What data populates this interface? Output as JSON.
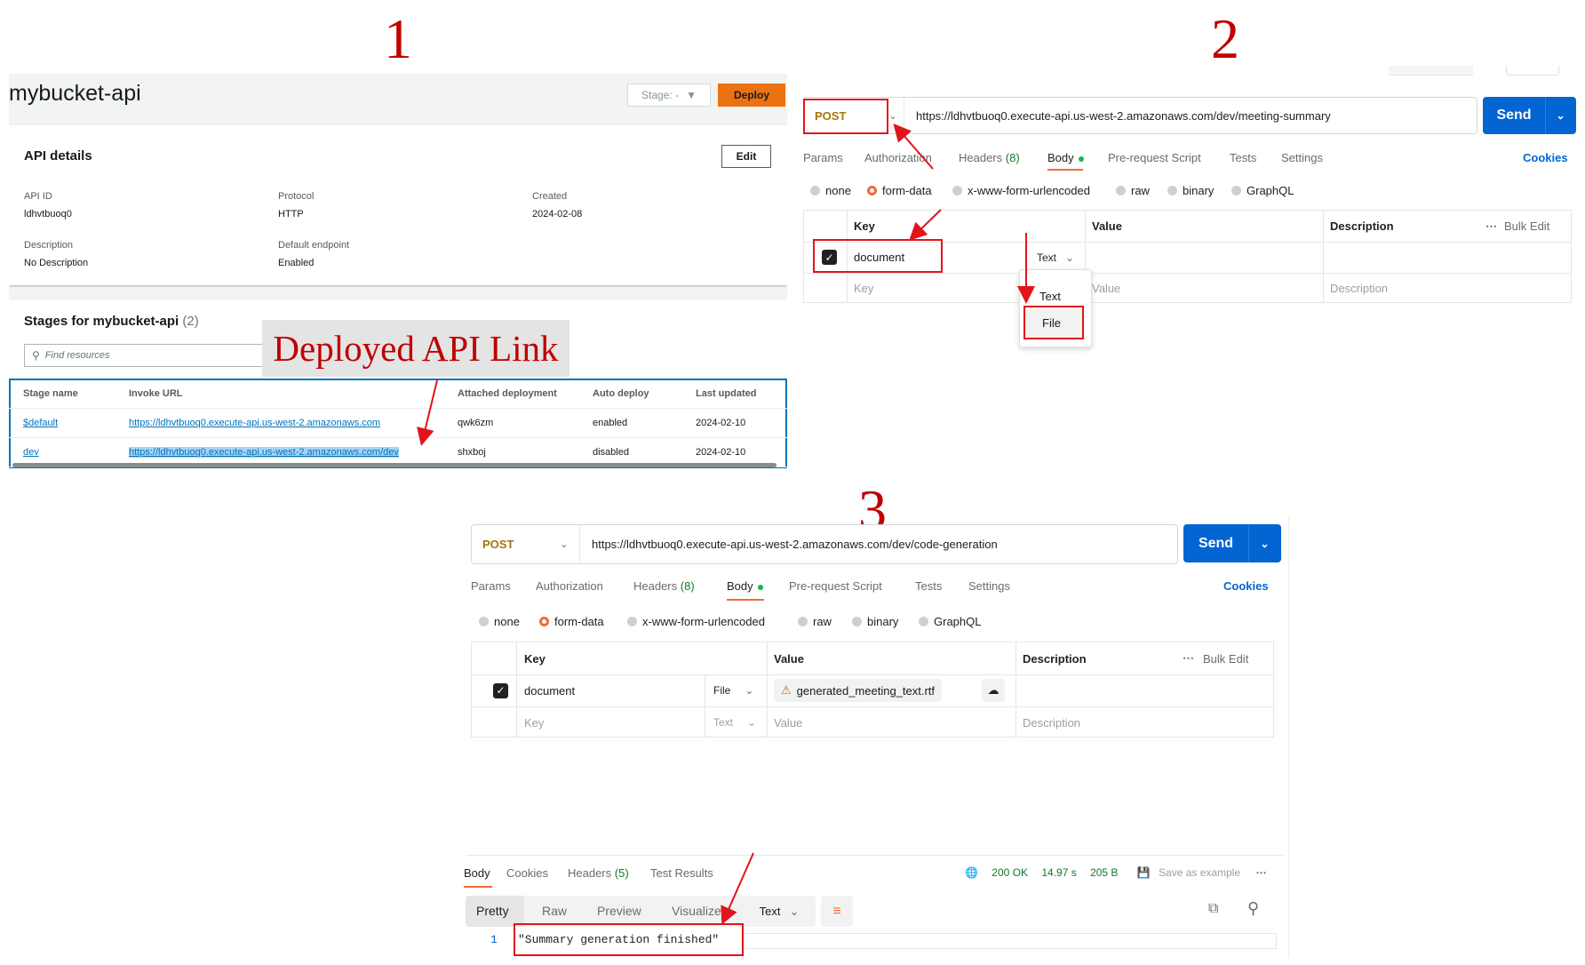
{
  "labels": {
    "step1": "1",
    "step2": "2",
    "step3": "3",
    "callout": "Deployed API Link"
  },
  "aws": {
    "api_name": "mybucket-api",
    "stage_select": "Stage: -",
    "deploy_label": "Deploy",
    "details_title": "API details",
    "edit_label": "Edit",
    "details": [
      {
        "key": "API ID",
        "value": "ldhvtbuoq0"
      },
      {
        "key": "Protocol",
        "value": "HTTP"
      },
      {
        "key": "Created",
        "value": "2024-02-08"
      },
      {
        "key": "Description",
        "value": "No Description"
      },
      {
        "key": "Default endpoint",
        "value": "Enabled"
      }
    ],
    "stages_title": "Stages for mybucket-api",
    "stages_count": "(2)",
    "search_placeholder": "Find resources",
    "columns": [
      "Stage name",
      "Invoke URL",
      "Attached deployment",
      "Auto deploy",
      "Last updated"
    ],
    "rows": [
      [
        "$default",
        "https://ldhvtbuoq0.execute-api.us-west-2.amazonaws.com",
        "qwk6zm",
        "enabled",
        "2024-02-10"
      ],
      [
        "dev",
        "https://ldhvtbuoq0.execute-api.us-west-2.amazonaws.com/dev",
        "shxboj",
        "disabled",
        "2024-02-10"
      ]
    ]
  },
  "pm2": {
    "method": "POST",
    "url": "https://ldhvtbuoq0.execute-api.us-west-2.amazonaws.com/dev/meeting-summary",
    "send": "Send",
    "tabs": [
      "Params",
      "Authorization",
      "Headers",
      "(8)",
      "Body",
      "Pre-request Script",
      "Tests",
      "Settings"
    ],
    "cookies": "Cookies",
    "body_types": [
      "none",
      "form-data",
      "x-www-form-urlencoded",
      "raw",
      "binary",
      "GraphQL"
    ],
    "table_headers": [
      "Key",
      "Value",
      "Description"
    ],
    "bulk_edit": "Bulk Edit",
    "row_key": "document",
    "row_type": "Text",
    "key_placeholder": "Key",
    "value_placeholder": "Value",
    "description_placeholder": "Description",
    "dropdown_options": [
      "Text",
      "File"
    ]
  },
  "pm3": {
    "method": "POST",
    "url": "https://ldhvtbuoq0.execute-api.us-west-2.amazonaws.com/dev/code-generation",
    "send": "Send",
    "tabs": [
      "Params",
      "Authorization",
      "Headers",
      "(8)",
      "Body",
      "Pre-request Script",
      "Tests",
      "Settings"
    ],
    "cookies": "Cookies",
    "body_types": [
      "none",
      "form-data",
      "x-www-form-urlencoded",
      "raw",
      "binary",
      "GraphQL"
    ],
    "table_headers": [
      "Key",
      "Value",
      "Description"
    ],
    "bulk_edit": "Bulk Edit",
    "row_key": "document",
    "row_type": "File",
    "file_name": "generated_meeting_text.rtf",
    "key_placeholder": "Key",
    "type_placeholder": "Text",
    "value_placeholder": "Value",
    "description_placeholder": "Description",
    "response": {
      "tabs": [
        "Body",
        "Cookies",
        "Headers",
        "(5)",
        "Test Results"
      ],
      "status": "200 OK",
      "time": "14.97 s",
      "size": "205 B",
      "save_example": "Save as example",
      "views": [
        "Pretty",
        "Raw",
        "Preview",
        "Visualize"
      ],
      "format": "Text",
      "line_number": "1",
      "body": "\"Summary generation finished\""
    }
  },
  "colors": {
    "annotation_red": "#e3131b",
    "postman_blue": "#0265d2",
    "aws_orange": "#ec7211"
  }
}
